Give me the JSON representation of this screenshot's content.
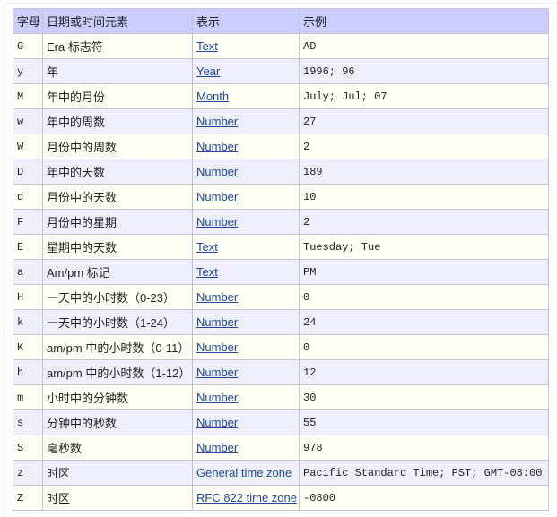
{
  "table": {
    "headers": [
      "字母",
      "日期或时间元素",
      "表示",
      "示例"
    ],
    "rows": [
      {
        "letter": "G",
        "element": "Era 标志符",
        "presentation": "Text",
        "example": "AD"
      },
      {
        "letter": "y",
        "element": "年",
        "presentation": "Year",
        "example": "1996; 96"
      },
      {
        "letter": "M",
        "element": "年中的月份",
        "presentation": "Month",
        "example": "July; Jul; 07"
      },
      {
        "letter": "w",
        "element": "年中的周数",
        "presentation": "Number",
        "example": "27"
      },
      {
        "letter": "W",
        "element": "月份中的周数",
        "presentation": "Number",
        "example": "2"
      },
      {
        "letter": "D",
        "element": "年中的天数",
        "presentation": "Number",
        "example": "189"
      },
      {
        "letter": "d",
        "element": "月份中的天数",
        "presentation": "Number",
        "example": "10"
      },
      {
        "letter": "F",
        "element": "月份中的星期",
        "presentation": "Number",
        "example": "2"
      },
      {
        "letter": "E",
        "element": "星期中的天数",
        "presentation": "Text",
        "example": "Tuesday; Tue"
      },
      {
        "letter": "a",
        "element": "Am/pm 标记",
        "presentation": "Text",
        "example": "PM"
      },
      {
        "letter": "H",
        "element": "一天中的小时数（0-23）",
        "presentation": "Number",
        "example": "0"
      },
      {
        "letter": "k",
        "element": "一天中的小时数（1-24）",
        "presentation": "Number",
        "example": "24"
      },
      {
        "letter": "K",
        "element": "am/pm 中的小时数（0-11）",
        "presentation": "Number",
        "example": "0"
      },
      {
        "letter": "h",
        "element": "am/pm 中的小时数（1-12）",
        "presentation": "Number",
        "example": "12"
      },
      {
        "letter": "m",
        "element": "小时中的分钟数",
        "presentation": "Number",
        "example": "30"
      },
      {
        "letter": "s",
        "element": "分钟中的秒数",
        "presentation": "Number",
        "example": "55"
      },
      {
        "letter": "S",
        "element": "毫秒数",
        "presentation": "Number",
        "example": "978"
      },
      {
        "letter": "z",
        "element": "时区",
        "presentation": "General time zone",
        "example": "Pacific Standard Time; PST; GMT-08:00"
      },
      {
        "letter": "Z",
        "element": "时区",
        "presentation": "RFC 822 time zone",
        "example": "-0800"
      }
    ]
  },
  "colors": {
    "header_bg": "#ccccff",
    "row_odd_bg": "#fffff5",
    "row_even_bg": "#eeeefc",
    "link": "#1a4a9c",
    "border": "#c4c4cc"
  }
}
